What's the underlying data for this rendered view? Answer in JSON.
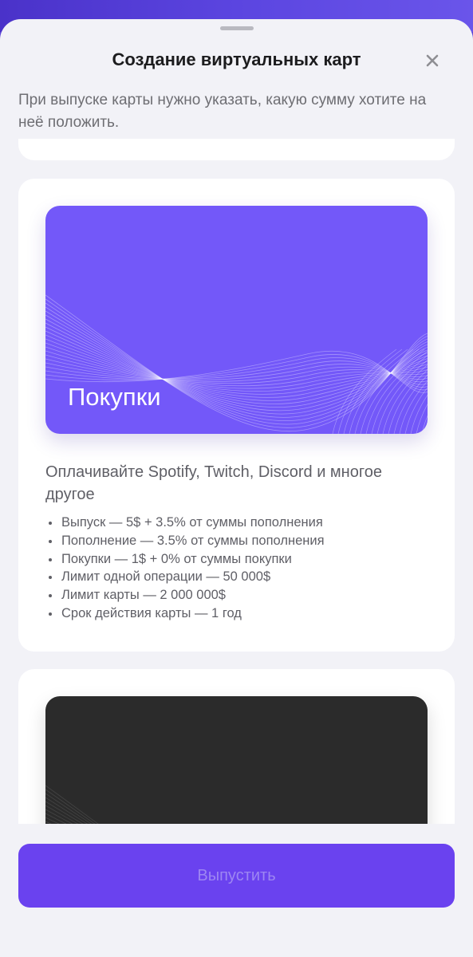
{
  "sheet": {
    "title": "Создание виртуальных карт",
    "subtitle": "При выпуске карты нужно указать, какую сумму хотите на неё положить."
  },
  "offers": [
    {
      "card_name": "Покупки",
      "card_color": "#7358f9",
      "description": "Оплачивайте Spotify, Twitch, Discord и многое другое",
      "features": [
        "Выпуск — 5$ + 3.5% от суммы пополнения",
        "Пополнение — 3.5% от суммы пополнения",
        "Покупки — 1$ + 0% от суммы покупки",
        "Лимит одной операции — 50 000$",
        "Лимит карты — 2 000 000$",
        "Срок действия карты — 1 год"
      ]
    },
    {
      "card_color": "#2b2b2b"
    }
  ],
  "footer": {
    "issue_button_label": "Выпустить",
    "button_color": "#6a42ef"
  },
  "icons": {
    "close": "close-icon"
  }
}
